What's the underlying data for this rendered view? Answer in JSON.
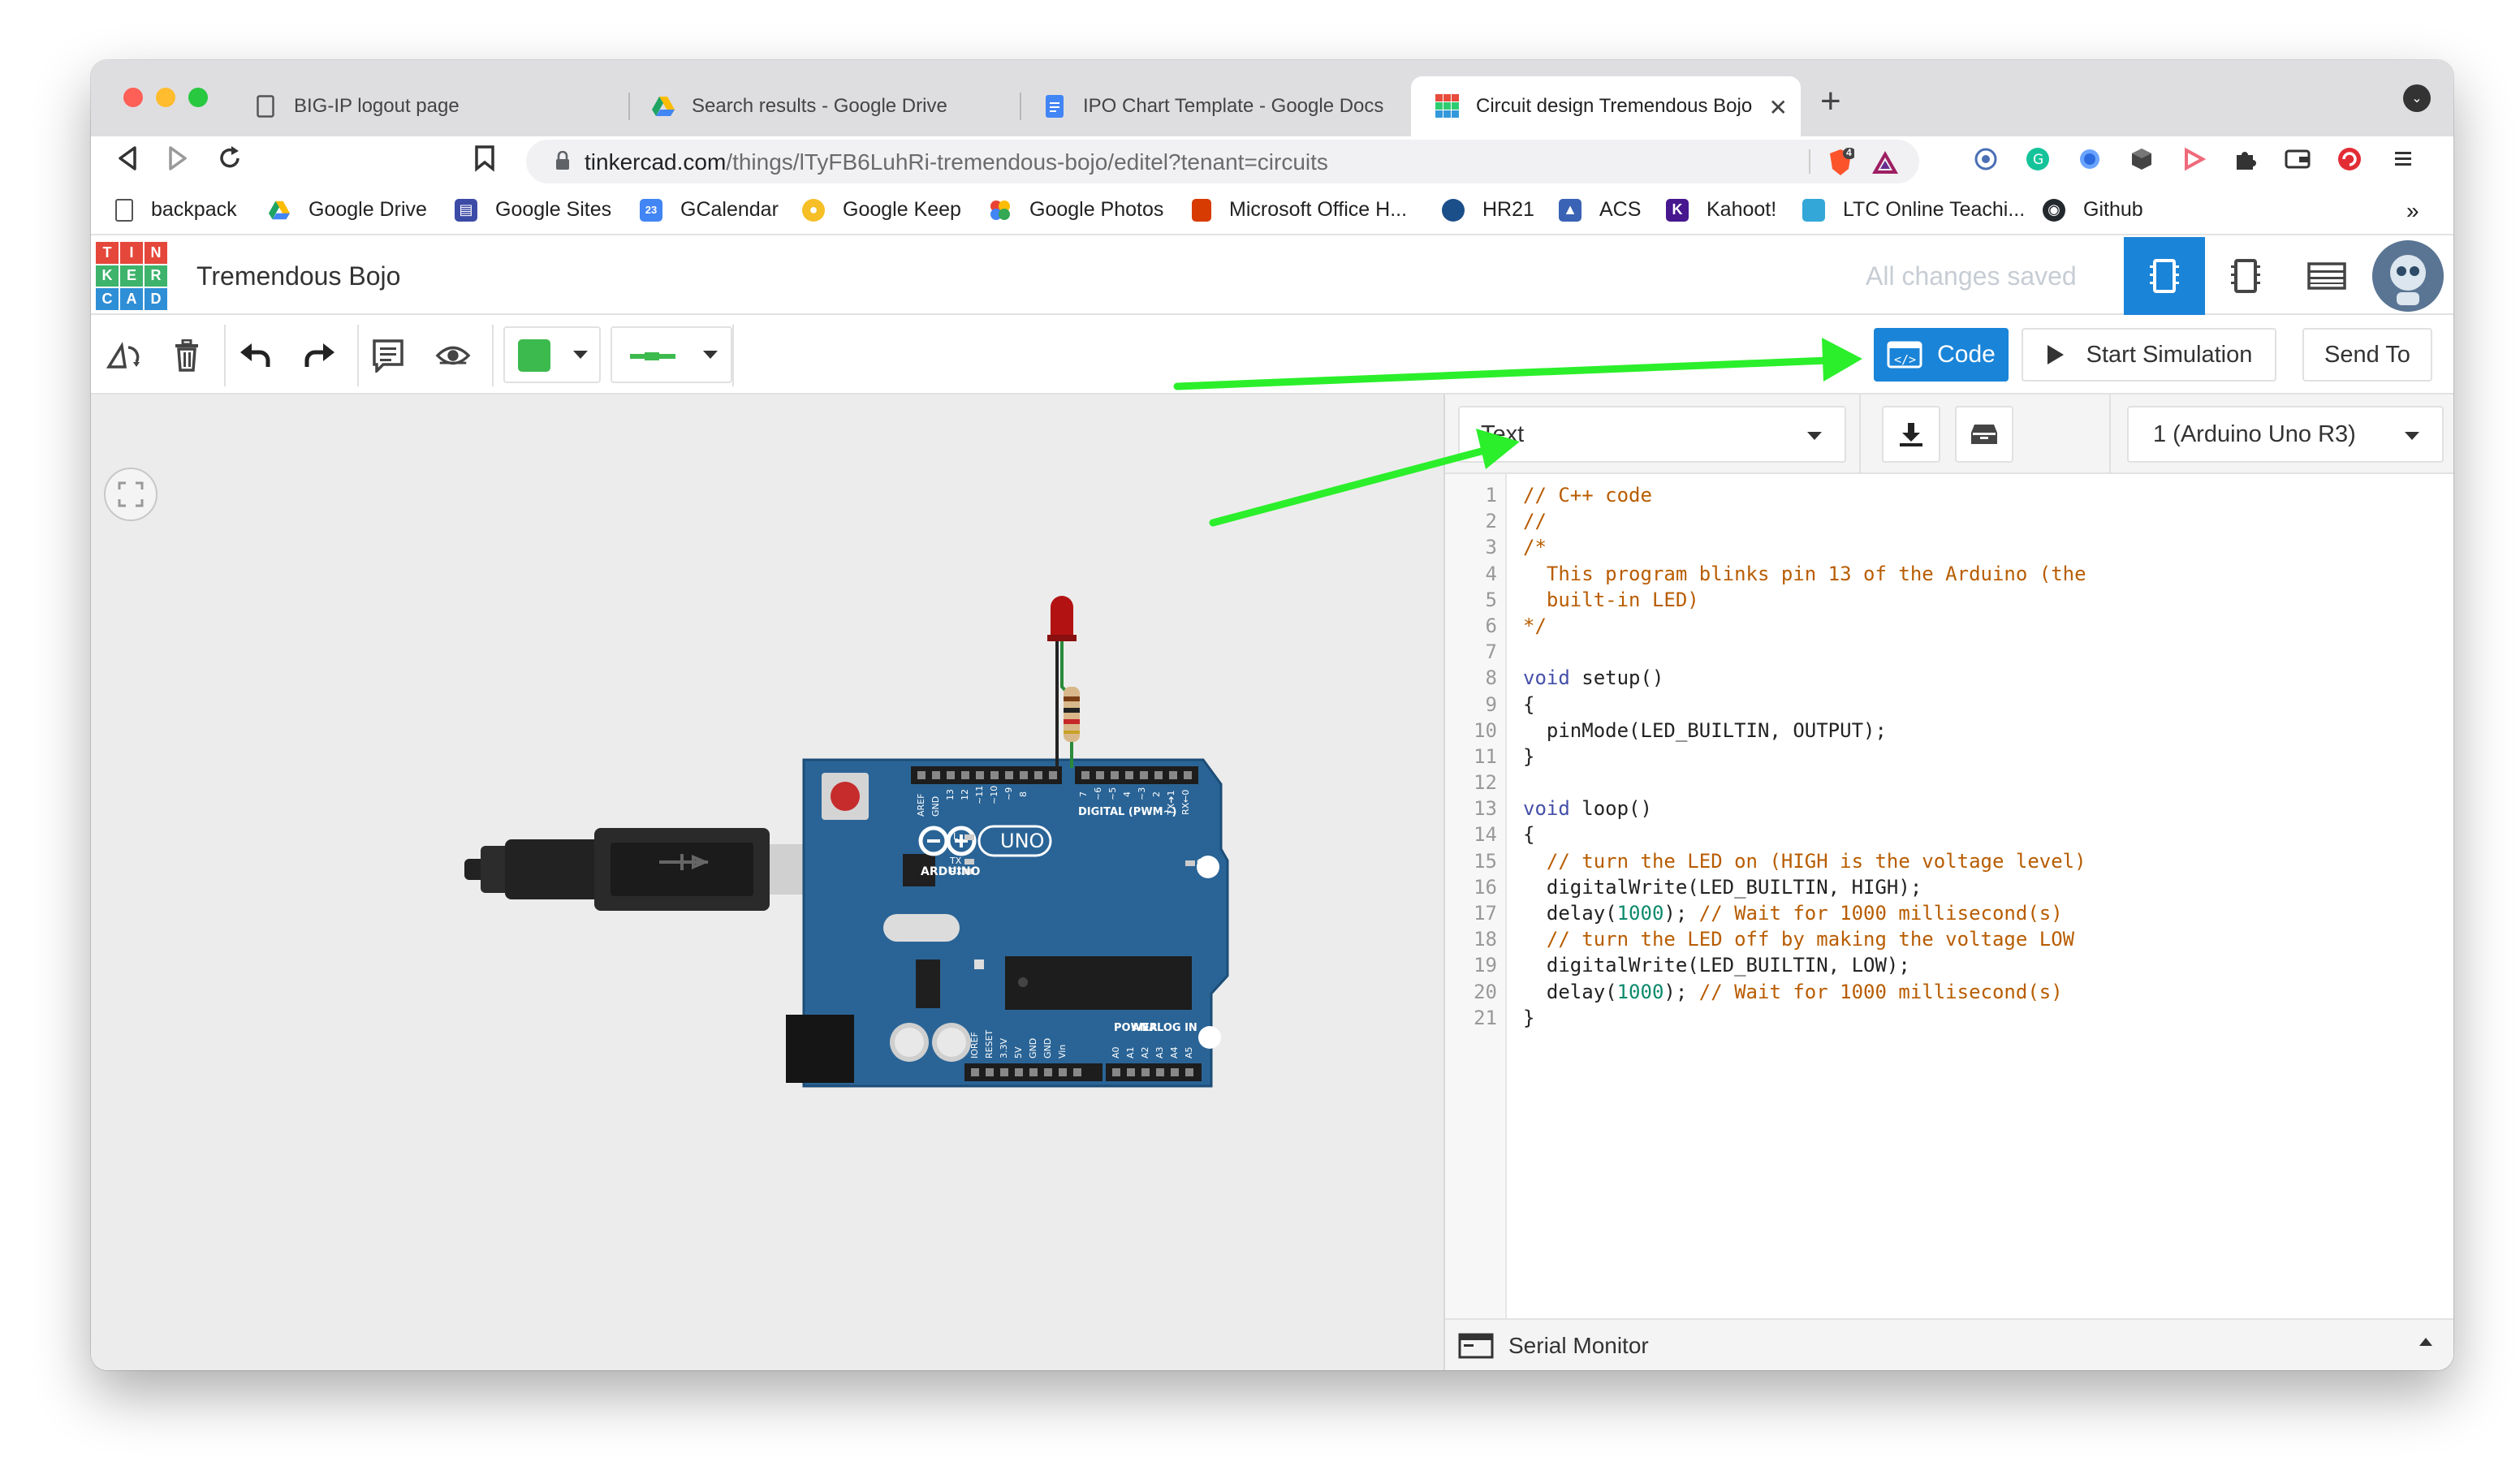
{
  "browser": {
    "tabs": [
      {
        "title": "BIG-IP logout page",
        "icon": "document-icon"
      },
      {
        "title": "Search results - Google Drive",
        "icon": "google-drive-icon"
      },
      {
        "title": "IPO Chart Template - Google Docs",
        "icon": "google-docs-icon"
      },
      {
        "title": "Circuit design Tremendous Bojo",
        "icon": "tinkercad-icon",
        "active": true
      }
    ],
    "url_host": "tinkercad.com",
    "url_path": "/things/lTyFB6LuhRi-tremendous-bojo/editel?tenant=circuits",
    "extension_badge": "4",
    "bookmarks": [
      {
        "label": "backpack",
        "color": "#ffffff"
      },
      {
        "label": "Google Drive",
        "color": "#1fa463"
      },
      {
        "label": "Google Sites",
        "color": "#3c4ba6"
      },
      {
        "label": "GCalendar",
        "color": "#4285f4"
      },
      {
        "label": "Google Keep",
        "color": "#f6bf26"
      },
      {
        "label": "Google Photos",
        "color": "#ea4335"
      },
      {
        "label": "Microsoft Office H...",
        "color": "#d83b01"
      },
      {
        "label": "HR21",
        "color": "#1b4f8a"
      },
      {
        "label": "ACS",
        "color": "#3a62b5"
      },
      {
        "label": "Kahoot!",
        "color": "#46178f"
      },
      {
        "label": "LTC Online Teachi...",
        "color": "#33a7d8"
      },
      {
        "label": "Github",
        "color": "#24292e"
      }
    ],
    "bookmarks_more": "»"
  },
  "tinkercad": {
    "logo_letters": [
      "T",
      "I",
      "N",
      "K",
      "E",
      "R",
      "C",
      "A",
      "D"
    ],
    "project_title": "Tremendous Bojo",
    "save_status": "All changes saved",
    "toolbar": {
      "code_label": "Code",
      "start_simulation_label": "Start Simulation",
      "send_to_label": "Send To",
      "color_swatch": "#3dba4e"
    },
    "code_panel": {
      "mode": "Text",
      "board": "1 (Arduino Uno R3)",
      "serial_monitor_label": "Serial Monitor",
      "lines": [
        "// C++ code",
        "//",
        "/*",
        "  This program blinks pin 13 of the Arduino (the",
        "  built-in LED)",
        "*/",
        "",
        "void setup()",
        "{",
        "  pinMode(LED_BUILTIN, OUTPUT);",
        "}",
        "",
        "void loop()",
        "{",
        "  // turn the LED on (HIGH is the voltage level)",
        "  digitalWrite(LED_BUILTIN, HIGH);",
        "  delay(1000); // Wait for 1000 millisecond(s)",
        "  // turn the LED off by making the voltage LOW",
        "  digitalWrite(LED_BUILTIN, LOW);",
        "  delay(1000); // Wait for 1000 millisecond(s)",
        "}"
      ]
    },
    "board_labels": {
      "brand": "ARDUINO",
      "model": "UNO",
      "digital": "DIGITAL (PWM~)",
      "power": "POWER",
      "analog": "ANALOG IN",
      "on": "ON",
      "tx": "TX",
      "rx": "RX",
      "l": "L",
      "aref": "AREF",
      "gnd": "GND",
      "pin13": "13",
      "pin12": "12",
      "pin11": "~11",
      "pin10": "~10",
      "pin9": "~9",
      "pin8": "8",
      "pin7": "7",
      "pin6": "~6",
      "pin5": "~5",
      "pin4": "4",
      "pin3": "~3",
      "pin2": "2",
      "pin1": "TX➔1",
      "pin0": "RX←0",
      "ioref": "IOREF",
      "reset": "RESET",
      "v33": "3.3V",
      "v5": "5V",
      "gnd1": "GND",
      "gnd2": "GND",
      "vin": "Vin",
      "a0": "A0",
      "a1": "A1",
      "a2": "A2",
      "a3": "A3",
      "a4": "A4",
      "a5": "A5"
    },
    "annotation_color": "#2bef2b",
    "led_color": "#b31212",
    "board_color": "#2a6496"
  }
}
